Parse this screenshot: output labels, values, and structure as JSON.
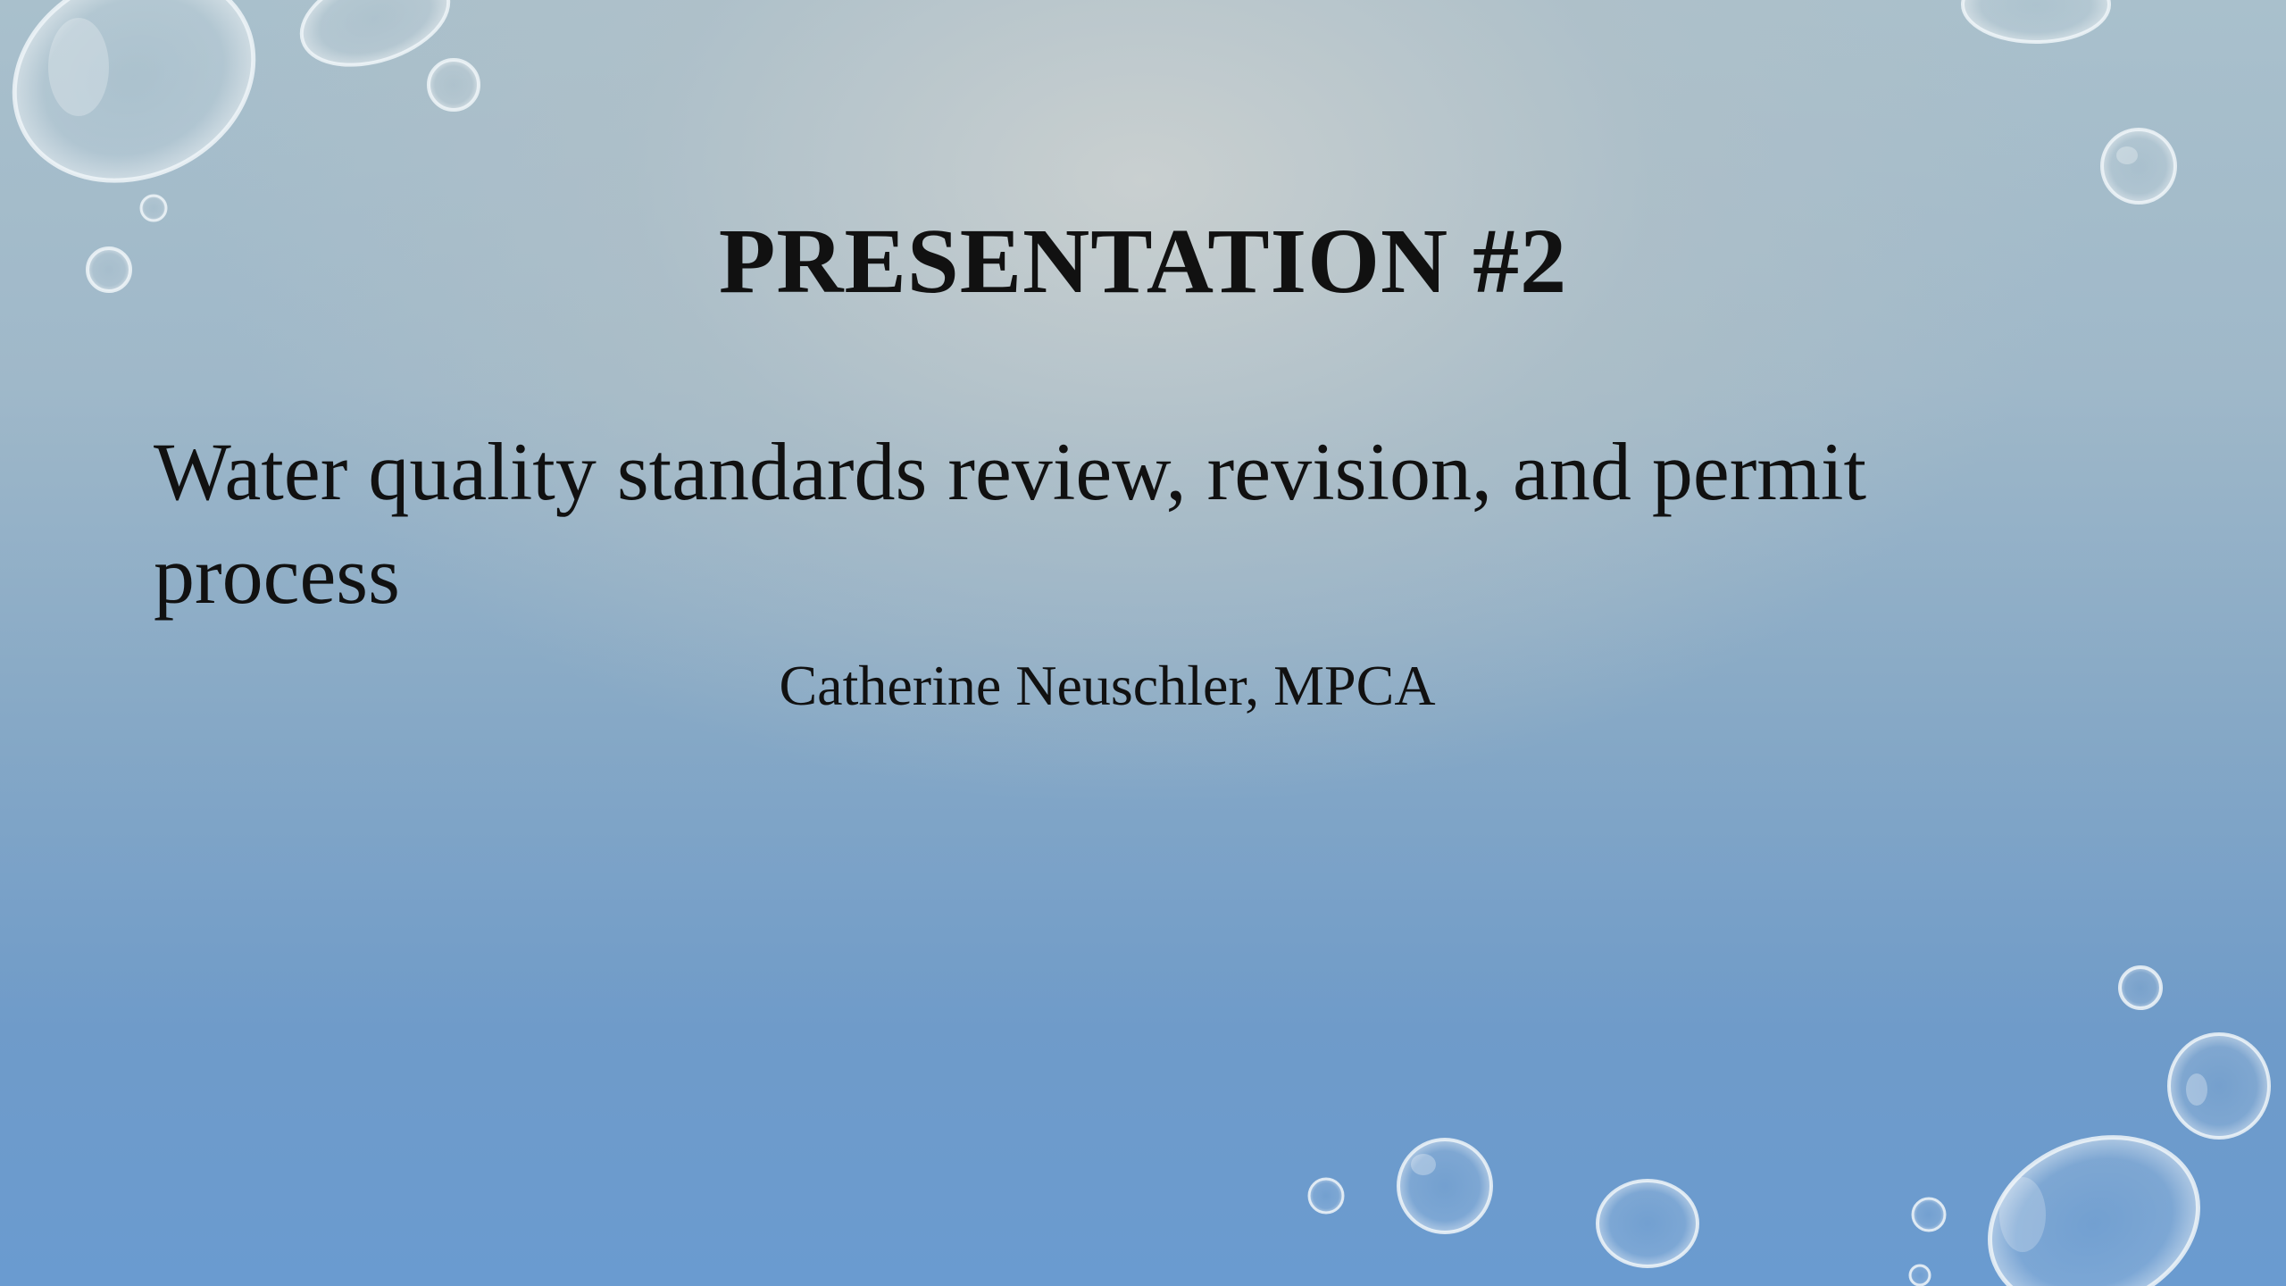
{
  "slide": {
    "title": "PRESENTATION #2",
    "subtitle": "Water quality standards review, revision, and permit process",
    "author": "Catherine Neuschler, MPCA"
  },
  "decoration": {
    "icon": "water-droplet-icon",
    "theme_colors": {
      "top": "#c9cfcf",
      "bottom": "#6a9bd0",
      "text": "#111111"
    }
  }
}
